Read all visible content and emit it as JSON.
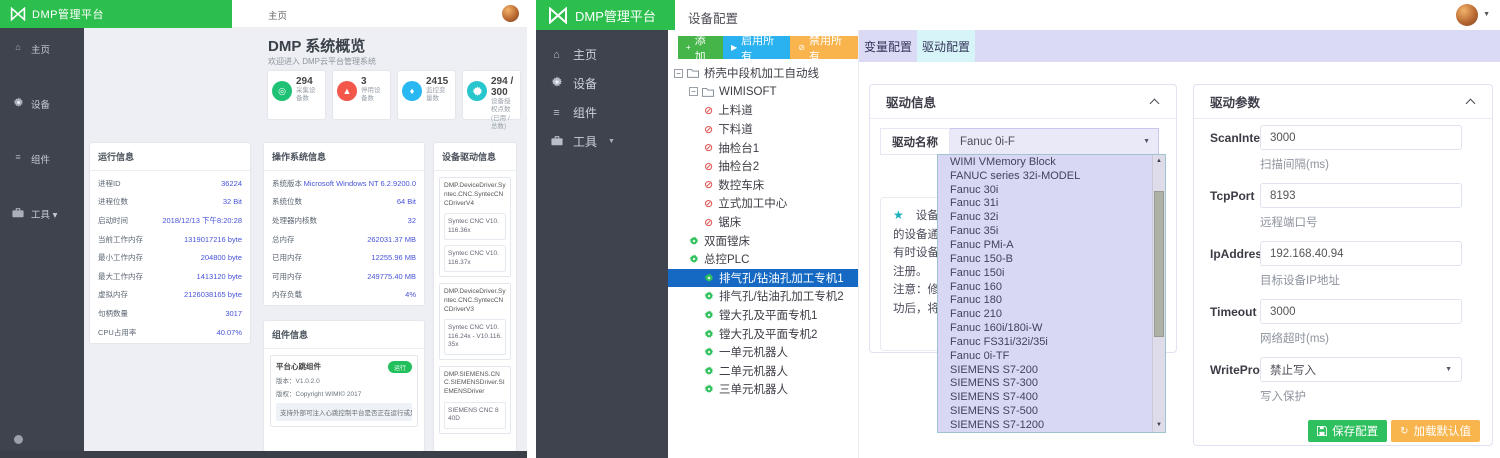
{
  "left_dashboard": {
    "brand": "DMP管理平台",
    "breadcrumb": "主页",
    "sidebar": {
      "items": [
        {
          "label": "主页",
          "icon": "home-icon"
        },
        {
          "label": "设备",
          "icon": "gears-icon"
        },
        {
          "label": "组件",
          "icon": "list-icon"
        },
        {
          "label": "工具",
          "icon": "briefcase-icon"
        }
      ]
    },
    "page_title": "DMP 系统概览",
    "page_subtitle": "欢迎进入 DMP云平台管理系统",
    "stats": [
      {
        "value": "294",
        "label": "采集设备数",
        "color": "#1fc274",
        "icon": "target-icon"
      },
      {
        "value": "3",
        "label": "停用设备数",
        "color": "#f25749",
        "icon": "warning-icon"
      },
      {
        "value": "2415",
        "label": "监控变量数",
        "color": "#29b8f2",
        "icon": "tag-icon"
      },
      {
        "value": "294 / 300",
        "label": "设备授权点数(已用 / 总数)",
        "color": "#26c6cc",
        "icon": "gears-icon"
      }
    ],
    "run_info": {
      "title": "运行信息",
      "rows": [
        [
          "进程ID",
          "36224"
        ],
        [
          "进程位数",
          "32 Bit"
        ],
        [
          "启动时间",
          "2018/12/13 下午8:20:28"
        ],
        [
          "当前工作内存",
          "1319017216 byte"
        ],
        [
          "最小工作内存",
          "204800 byte"
        ],
        [
          "最大工作内存",
          "1413120 byte"
        ],
        [
          "虚拟内存",
          "2126038165 byte"
        ],
        [
          "句柄数量",
          "3017"
        ],
        [
          "CPU占用率",
          "40.07%"
        ]
      ]
    },
    "os_info": {
      "title": "操作系统信息",
      "rows": [
        [
          "系统版本",
          "Microsoft Windows NT 6.2.9200.0"
        ],
        [
          "系统位数",
          "64 Bit"
        ],
        [
          "处理器内核数",
          "32"
        ],
        [
          "总内存",
          "262031.37 MB"
        ],
        [
          "已用内存",
          "12255.96 MB"
        ],
        [
          "可用内存",
          "249775.40 MB"
        ],
        [
          "内存负载",
          "4%"
        ]
      ]
    },
    "driver_info": {
      "title": "设备驱动信息",
      "groups": [
        {
          "name": "DMP.DeviceDriver.Syntec.CNC.SyntecCNCDriverV4",
          "versions": [
            "Syntec CNC V10.116.36x",
            "Syntec CNC V10.116.37x"
          ]
        },
        {
          "name": "DMP.DeviceDriver.Syntec.CNC.SyntecCNCDriverV3",
          "versions": [
            "Syntec CNC V10.116.24x - V10.116.35x"
          ]
        },
        {
          "name": "DMP.SIEMENS.CNC.SIEMENSDriver.SIEMENSDriver",
          "versions": [
            "SIEMENS CNC 840D"
          ]
        }
      ]
    },
    "component_info": {
      "title": "组件信息",
      "name": "平台心跳组件",
      "badge": "运行",
      "version": "版本：V1.0.2.0",
      "copyright": "版权：Copyright WIMI© 2017",
      "desc": "支持外部可注入心跳控制平台是否正在运行或是否挂掉，并支持平台进行热重启运行"
    }
  },
  "app": {
    "brand": "DMP管理平台",
    "topbar_title": "设备配置",
    "sidebar": [
      {
        "label": "主页",
        "icon": "home-icon"
      },
      {
        "label": "设备",
        "icon": "gears-icon"
      },
      {
        "label": "组件",
        "icon": "list-icon"
      },
      {
        "label": "工具",
        "icon": "briefcase-icon",
        "caret": true
      }
    ],
    "tree_toolbar": [
      {
        "label": "添加",
        "icon": "plus-icon",
        "color": "#45b549"
      },
      {
        "label": "启用所有",
        "icon": "play-icon",
        "color": "#29b2ef"
      },
      {
        "label": "禁用所有",
        "icon": "ban-icon",
        "color": "#f9b44e"
      }
    ],
    "tree_nodes": [
      {
        "label": "桥壳中段机加工自动线",
        "type": "folder",
        "indent": 0
      },
      {
        "label": "WIMISOFT",
        "type": "folder",
        "indent": 1
      },
      {
        "label": "上料道",
        "type": "disabled",
        "indent": 2
      },
      {
        "label": "下料道",
        "type": "disabled",
        "indent": 2
      },
      {
        "label": "抽检台1",
        "type": "disabled",
        "indent": 2
      },
      {
        "label": "抽检台2",
        "type": "disabled",
        "indent": 2
      },
      {
        "label": "数控车床",
        "type": "disabled",
        "indent": 2
      },
      {
        "label": "立式加工中心",
        "type": "disabled",
        "indent": 2
      },
      {
        "label": "锯床",
        "type": "disabled",
        "indent": 2
      },
      {
        "label": "双面镗床",
        "type": "enabled",
        "indent": 1
      },
      {
        "label": "总控PLC",
        "type": "enabled",
        "indent": 1
      },
      {
        "label": "排气孔/钻油孔加工专机1",
        "type": "enabled",
        "indent": 2,
        "selected": true
      },
      {
        "label": "排气孔/钻油孔加工专机2",
        "type": "enabled",
        "indent": 2
      },
      {
        "label": "镗大孔及平面专机1",
        "type": "enabled",
        "indent": 2
      },
      {
        "label": "镗大孔及平面专机2",
        "type": "enabled",
        "indent": 2
      },
      {
        "label": "一单元机器人",
        "type": "enabled",
        "indent": 2
      },
      {
        "label": "二单元机器人",
        "type": "enabled",
        "indent": 2
      },
      {
        "label": "三单元机器人",
        "type": "enabled",
        "indent": 2
      }
    ],
    "tabs": [
      {
        "label": "变量配置",
        "active": false
      },
      {
        "label": "驱动配置",
        "active": true
      }
    ],
    "driver_info_card": {
      "title": "驱动信息",
      "field_label": "驱动名称",
      "selected_driver": "Fanuc 0i-F",
      "note_lines": [
        "设备驱",
        "的设备通讯",
        "有时设备驱",
        "注册。",
        "注意：修改",
        "功后，将"
      ]
    },
    "driver_dropdown_options": [
      "WIMI VMemory Block",
      "FANUC series 32i-MODEL",
      "Fanuc 30i",
      "Fanuc 31i",
      "Fanuc 32i",
      "Fanuc 35i",
      "Fanuc PMi-A",
      "Fanuc 150-B",
      "Fanuc 150i",
      "Fanuc 160",
      "Fanuc 180",
      "Fanuc 210",
      "Fanuc 160i/180i-W",
      "Fanuc FS31i/32i/35i",
      "Fanuc 0i-TF",
      "SIEMENS S7-200",
      "SIEMENS S7-300",
      "SIEMENS S7-400",
      "SIEMENS S7-500",
      "SIEMENS S7-1200"
    ],
    "driver_params_card": {
      "title": "驱动参数",
      "fields": [
        {
          "label": "ScanInterval",
          "value": "3000",
          "hint": "扫描间隔(ms)",
          "type": "input"
        },
        {
          "label": "TcpPort",
          "value": "8193",
          "hint": "远程端口号",
          "type": "input"
        },
        {
          "label": "IpAddress",
          "value": "192.168.40.94",
          "hint": "目标设备IP地址",
          "type": "input"
        },
        {
          "label": "Timeout",
          "value": "3000",
          "hint": "网络超时(ms)",
          "type": "input"
        },
        {
          "label": "WriteProtect",
          "value": "禁止写入",
          "hint": "写入保护",
          "type": "select"
        }
      ],
      "buttons": [
        {
          "label": "保存配置",
          "icon": "save-icon",
          "color": "#2ebf5f"
        },
        {
          "label": "加载默认值",
          "icon": "refresh-icon",
          "color": "#f8b54e"
        }
      ]
    }
  }
}
